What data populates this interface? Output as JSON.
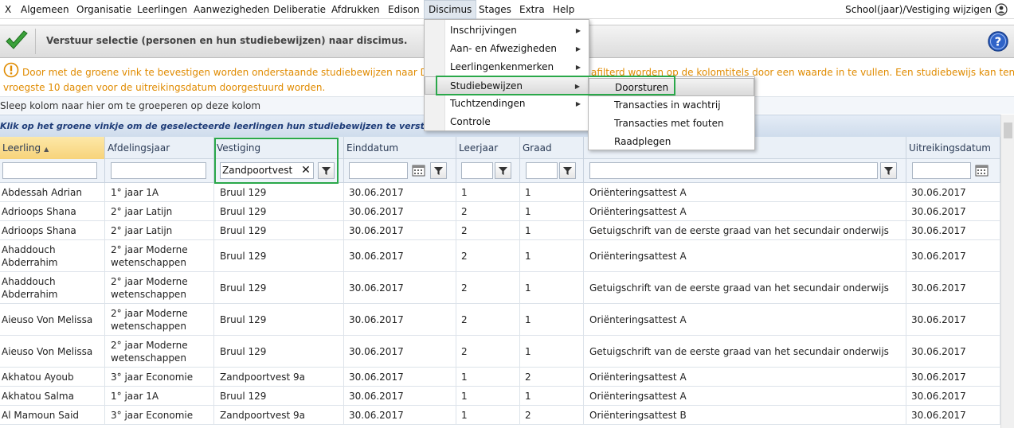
{
  "menubar": {
    "items": [
      "Algemeen",
      "Organisatie",
      "Leerlingen",
      "Aanwezigheden",
      "Deliberatie",
      "Afdrukken",
      "Edison",
      "Discimus",
      "Stages",
      "Extra",
      "Help"
    ],
    "right_label": "School(jaar)/Vestiging wijzigen",
    "close_label": "X"
  },
  "action_bar": {
    "text": "Verstuur selectie (personen en hun studiebewijzen) naar discimus."
  },
  "info": {
    "line1_left": "Door met de groene vink te bevestigen worden onderstaande studiebewijzen naar Dis",
    "line1_right": "afilterd worden op de kolomtitels door een waarde in te vullen. Een studiebewijs kan ten",
    "line2": "vroegste 10 dagen voor de uitreikingsdatum doorgestuurd worden."
  },
  "group_hint": "Sleep kolom naar hier om te groeperen op deze kolom",
  "grid_hint": "Klik op het groene vinkje om de geselecteerde leerlingen hun studiebewijzen te versturen naar D",
  "grid": {
    "columns": [
      "Leerling",
      "Afdelingsjaar",
      "Vestiging",
      "Einddatum",
      "Leerjaar",
      "Graad",
      "",
      "Uitreikingsdatum"
    ],
    "filters": {
      "vestiging": "Zandpoortvest",
      "clear_glyph": "✕"
    },
    "rows": [
      [
        "Abdessah Adrian",
        "1° jaar 1A",
        "Bruul 129",
        "30.06.2017",
        "1",
        "1",
        "Oriënteringsattest A",
        "30.06.2017"
      ],
      [
        "Adrioops Shana",
        "2° jaar Latijn",
        "Bruul 129",
        "30.06.2017",
        "2",
        "1",
        "Oriënteringsattest A",
        "30.06.2017"
      ],
      [
        "Adrioops Shana",
        "2° jaar Latijn",
        "Bruul 129",
        "30.06.2017",
        "2",
        "1",
        "Getuigschrift van de eerste graad van het secundair onderwijs",
        "30.06.2017"
      ],
      [
        "Ahaddouch Abderrahim",
        "2° jaar Moderne wetenschappen",
        "Bruul 129",
        "30.06.2017",
        "2",
        "1",
        "Oriënteringsattest A",
        "30.06.2017"
      ],
      [
        "Ahaddouch Abderrahim",
        "2° jaar Moderne wetenschappen",
        "Bruul 129",
        "30.06.2017",
        "2",
        "1",
        "Getuigschrift van de eerste graad van het secundair onderwijs",
        "30.06.2017"
      ],
      [
        "Aieuso Von Melissa",
        "2° jaar Moderne wetenschappen",
        "Bruul 129",
        "30.06.2017",
        "2",
        "1",
        "Oriënteringsattest A",
        "30.06.2017"
      ],
      [
        "Aieuso Von Melissa",
        "2° jaar Moderne wetenschappen",
        "Bruul 129",
        "30.06.2017",
        "2",
        "1",
        "Getuigschrift van de eerste graad van het secundair onderwijs",
        "30.06.2017"
      ],
      [
        "Akhatou Ayoub",
        "3° jaar Economie",
        "Zandpoortvest 9a",
        "30.06.2017",
        "1",
        "2",
        "Oriënteringsattest A",
        "30.06.2017"
      ],
      [
        "Akhatou Salma",
        "1° jaar 1A",
        "Bruul 129",
        "30.06.2017",
        "1",
        "1",
        "Oriënteringsattest A",
        "30.06.2017"
      ],
      [
        "Al Mamoun Said",
        "3° jaar Economie",
        "Zandpoortvest 9a",
        "30.06.2017",
        "1",
        "2",
        "Oriënteringsattest B",
        "30.06.2017"
      ]
    ]
  },
  "discimus_menu": {
    "items": [
      "Inschrijvingen",
      "Aan- en Afwezigheden",
      "Leerlingenkenmerken",
      "Studiebewijzen",
      "Tuchtzendingen",
      "Controle"
    ]
  },
  "studiebewijzen_menu": {
    "items": [
      "Doorsturen",
      "Transacties in wachtrij",
      "Transacties met fouten",
      "Raadplegen"
    ]
  },
  "colors": {
    "highlight_box": "#2aa84a",
    "info_text": "#e08b00",
    "hint_text": "#1e3c78"
  }
}
